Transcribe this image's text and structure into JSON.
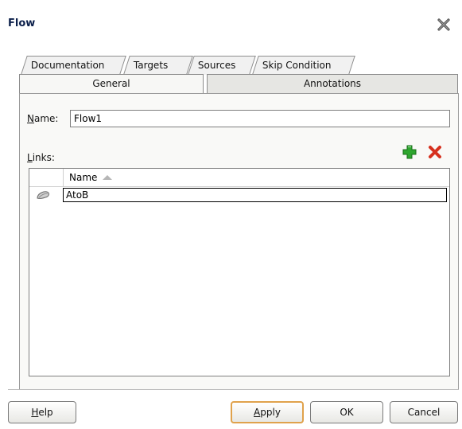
{
  "window": {
    "title": "Flow",
    "close_icon": "close-icon"
  },
  "tabs": {
    "back_row": [
      {
        "label": "Documentation"
      },
      {
        "label": "Targets"
      },
      {
        "label": "Sources"
      },
      {
        "label": "Skip Condition"
      }
    ],
    "front_row": [
      {
        "label": "General",
        "selected": true
      },
      {
        "label": "Annotations",
        "selected": false
      }
    ]
  },
  "form": {
    "name_label_accel": "N",
    "name_label_rest": "ame:",
    "name_value": "Flow1",
    "links_label_accel": "L",
    "links_label_rest": "inks:"
  },
  "links_table": {
    "columns": [
      {
        "label": ""
      },
      {
        "label": "Name",
        "sort": "ascending"
      }
    ],
    "rows": [
      {
        "icon": "link-icon",
        "name": "AtoB"
      }
    ]
  },
  "toolbar": {
    "add_icon": "add-icon",
    "delete_icon": "delete-icon"
  },
  "buttons": {
    "help_accel": "H",
    "help_rest": "elp",
    "apply_accel": "A",
    "apply_rest": "pply",
    "ok": "OK",
    "cancel": "Cancel"
  },
  "colors": {
    "accent_default_button": "#e0a24c",
    "add_green": "#2ea62e",
    "delete_red": "#d6301e"
  }
}
